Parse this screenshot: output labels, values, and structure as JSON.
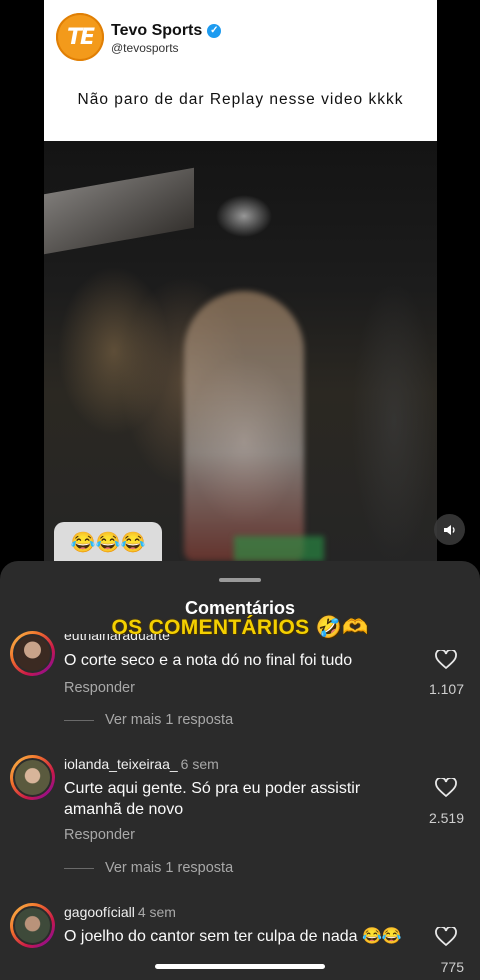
{
  "post": {
    "account_name": "Tevo Sports",
    "handle": "@tevosports",
    "logo_text": "TE",
    "text": "Não paro de dar Replay nesse video kkkk"
  },
  "video": {
    "emoji_bubble": "😂😂😂"
  },
  "sheet": {
    "title": "Comentários",
    "overlay_caption": "OS COMENTÁRIOS 🤣🫶"
  },
  "comments": [
    {
      "username": "euthainaraduarte",
      "time": "",
      "text": "O corte seco e a nota dó no final foi tudo",
      "reply_label": "Responder",
      "view_more": "Ver mais 1 resposta",
      "likes": "1.107"
    },
    {
      "username": "iolanda_teixeiraa_",
      "time": "6 sem",
      "text": "Curte aqui gente. Só pra eu poder assistir amanhã de novo",
      "reply_label": "Responder",
      "view_more": "Ver mais 1 resposta",
      "likes": "2.519"
    },
    {
      "username": "gagoofíciall",
      "time": "4 sem",
      "text": "O joelho do cantor sem ter culpa de nada 😂😂",
      "likes": "775"
    }
  ],
  "colors": {
    "logo_orange": "#f39a1b",
    "verified_blue": "#1d9bf0",
    "sheet_bg": "#2b2b2b",
    "caption_yellow": "#f4d000"
  }
}
